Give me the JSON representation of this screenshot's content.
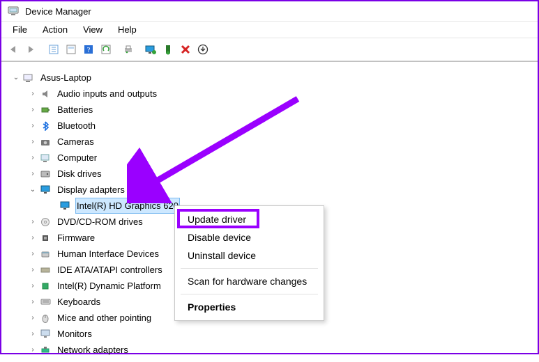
{
  "window": {
    "title": "Device Manager"
  },
  "menubar": {
    "items": [
      "File",
      "Action",
      "View",
      "Help"
    ]
  },
  "toolbar": {
    "buttons": [
      "back",
      "forward",
      "show-hidden",
      "properties",
      "help",
      "refresh",
      "print",
      "monitor",
      "install",
      "remove",
      "update"
    ]
  },
  "tree": {
    "root": {
      "label": "Asus-Laptop",
      "expanded": true
    },
    "categories": [
      {
        "label": "Audio inputs and outputs",
        "expanded": false,
        "icon": "audio"
      },
      {
        "label": "Batteries",
        "expanded": false,
        "icon": "battery"
      },
      {
        "label": "Bluetooth",
        "expanded": false,
        "icon": "bluetooth"
      },
      {
        "label": "Cameras",
        "expanded": false,
        "icon": "camera"
      },
      {
        "label": "Computer",
        "expanded": false,
        "icon": "computer"
      },
      {
        "label": "Disk drives",
        "expanded": false,
        "icon": "disk"
      },
      {
        "label": "Display adapters",
        "expanded": true,
        "icon": "display",
        "children": [
          {
            "label": "Intel(R) HD Graphics 620",
            "selected": true,
            "icon": "display"
          }
        ]
      },
      {
        "label": "DVD/CD-ROM drives",
        "expanded": false,
        "icon": "dvd"
      },
      {
        "label": "Firmware",
        "expanded": false,
        "icon": "firmware"
      },
      {
        "label": "Human Interface Devices",
        "expanded": false,
        "icon": "hid"
      },
      {
        "label": "IDE ATA/ATAPI controllers",
        "expanded": false,
        "icon": "ide"
      },
      {
        "label": "Intel(R) Dynamic Platform",
        "expanded": false,
        "icon": "intel"
      },
      {
        "label": "Keyboards",
        "expanded": false,
        "icon": "keyboard"
      },
      {
        "label": "Mice and other pointing",
        "expanded": false,
        "icon": "mouse"
      },
      {
        "label": "Monitors",
        "expanded": false,
        "icon": "monitor"
      },
      {
        "label": "Network adapters",
        "expanded": false,
        "icon": "network"
      }
    ]
  },
  "context_menu": {
    "items": [
      {
        "label": "Update driver",
        "highlighted": true
      },
      {
        "label": "Disable device"
      },
      {
        "label": "Uninstall device"
      },
      {
        "sep": true
      },
      {
        "label": "Scan for hardware changes"
      },
      {
        "sep": true
      },
      {
        "label": "Properties",
        "bold": true
      }
    ]
  },
  "annotation": {
    "arrow_color": "#9a00ff"
  }
}
